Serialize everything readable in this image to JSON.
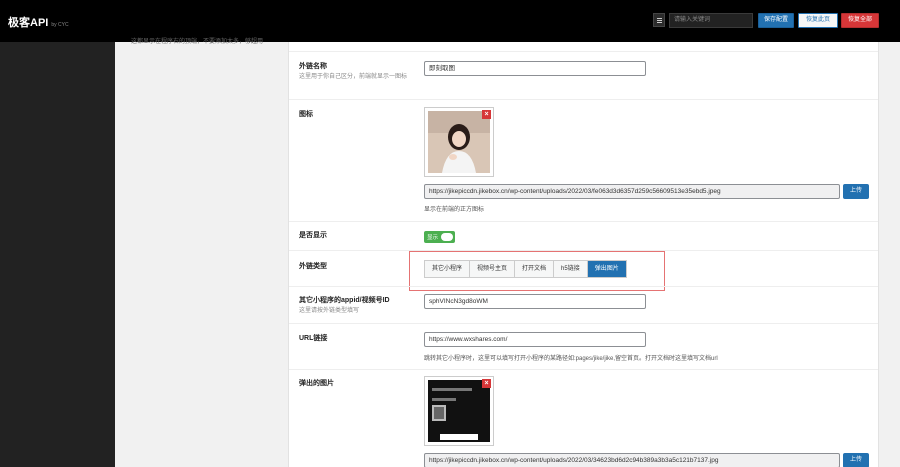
{
  "header": {
    "brand": "极客API",
    "brand_by": "by CYC",
    "menu_icon": "list-icon",
    "search_placeholder": "请输入关键词",
    "save_label": "保存配置",
    "reset_label": "恢复此页",
    "reset_all_label": "恢复全部",
    "colors": {
      "save": "#2271b1",
      "reset_all": "#d63638",
      "bar": "#000000"
    }
  },
  "sidebar": {
    "description": "这都显示在程序右的顶端，不要添加太多，够超用"
  },
  "form": {
    "link_name": {
      "label": "外链名称",
      "desc": "这里用于你自己区分，前端就显示一图标",
      "value": "即刻取图"
    },
    "icon": {
      "label": "图标",
      "url": "https://jikepiccdn.jikebox.cn/wp-content/uploads/2022/03/fe063d3d6357d259c56609513e35ebd5.jpeg",
      "upload_label": "上传",
      "note": "显示在前端的正方图标"
    },
    "show": {
      "label": "是否显示",
      "toggle_text": "显示",
      "on": true
    },
    "link_type": {
      "label": "外链类型",
      "options": [
        "其它小程序",
        "视频号主页",
        "打开文档",
        "h5链接",
        "弹出图片"
      ],
      "selected": "弹出图片"
    },
    "appid": {
      "label": "其它小程序的appid/视频号ID",
      "desc": "这里请按外链类型填写",
      "value": "sphVINcN3gd8oWM"
    },
    "url_link": {
      "label": "URL链接",
      "value": "https://www.wxshares.com/",
      "note": "跳转其它小程序时，这里可以填写打开小程序的某路径如:pages/jike/jike,留空首页。打开文档时这里填写文档url"
    },
    "popup_image": {
      "label": "弹出的图片",
      "url": "https://jikepiccdn.jikebox.cn/wp-content/uploads/2022/03/34623bd6d2c94b389a3b3a5c121b7137.jpg",
      "upload_label": "上传"
    }
  }
}
